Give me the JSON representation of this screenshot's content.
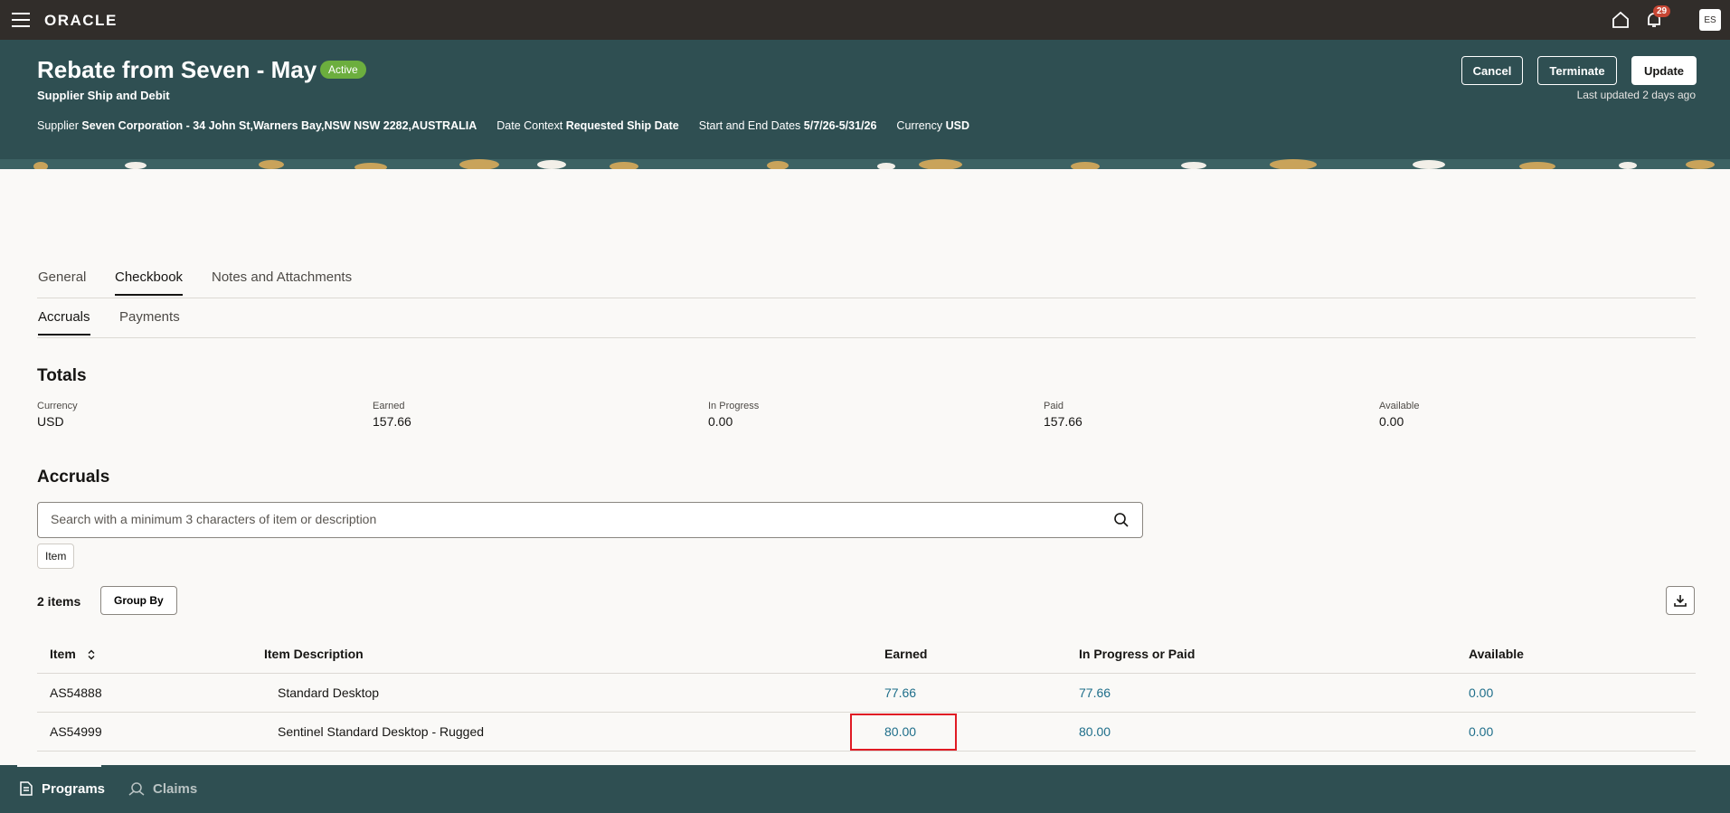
{
  "topbar": {
    "logo": "ORACLE",
    "notification_count": "29",
    "avatar_initials": "ES"
  },
  "header": {
    "title": "Rebate from Seven - May",
    "status": "Active",
    "subtitle": "Supplier Ship and Debit",
    "meta": [
      {
        "label": "Supplier",
        "value": "Seven Corporation - 34 John St,Warners Bay,NSW NSW 2282,AUSTRALIA"
      },
      {
        "label": "Date Context",
        "value": "Requested Ship Date"
      },
      {
        "label": "Start and End Dates",
        "value": "5/7/26-5/31/26"
      },
      {
        "label": "Currency",
        "value": "USD"
      }
    ],
    "buttons": {
      "cancel": "Cancel",
      "terminate": "Terminate",
      "update": "Update"
    },
    "last_updated": "Last updated 2 days ago"
  },
  "tabs": [
    "General",
    "Checkbook",
    "Notes and Attachments"
  ],
  "active_tab": "Checkbook",
  "subtabs": [
    "Accruals",
    "Payments"
  ],
  "active_subtab": "Accruals",
  "totals": {
    "title": "Totals",
    "items": [
      {
        "label": "Currency",
        "value": "USD"
      },
      {
        "label": "Earned",
        "value": "157.66"
      },
      {
        "label": "In Progress",
        "value": "0.00"
      },
      {
        "label": "Paid",
        "value": "157.66"
      },
      {
        "label": "Available",
        "value": "0.00"
      }
    ]
  },
  "accruals": {
    "title": "Accruals",
    "search_placeholder": "Search with a minimum 3 characters of item or description",
    "filter_chip": "Item",
    "count": "2 items",
    "group_by": "Group By",
    "columns": [
      "Item",
      "Item Description",
      "Earned",
      "In Progress or Paid",
      "Available"
    ],
    "rows": [
      {
        "item": "AS54888",
        "description": "Standard Desktop",
        "earned": "77.66",
        "in_progress_or_paid": "77.66",
        "available": "0.00"
      },
      {
        "item": "AS54999",
        "description": "Sentinel Standard Desktop - Rugged",
        "earned": "80.00",
        "in_progress_or_paid": "80.00",
        "available": "0.00"
      }
    ]
  },
  "bottom_nav": [
    {
      "label": "Programs",
      "icon": "document-icon"
    },
    {
      "label": "Claims",
      "icon": "claims-icon"
    }
  ],
  "colors": {
    "header_bg": "#2f4f52",
    "topbar_bg": "#312d2a",
    "link": "#1e6e8a",
    "status_active": "#6cae3e",
    "highlight": "#e01b24"
  }
}
